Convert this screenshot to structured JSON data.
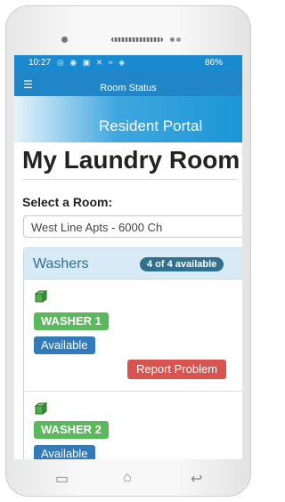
{
  "status_bar": {
    "time": "10:27",
    "icons": "◎ ◉ ▣ ✕ ≈ ◈",
    "battery": "86%"
  },
  "app_bar": {
    "menu_icon": "hamburger-icon",
    "title": "Room Status"
  },
  "banner": {
    "title": "Resident Portal"
  },
  "page": {
    "title": "My Laundry Room"
  },
  "room_select": {
    "label": "Select a Room:",
    "value": "West Line Apts - 6000 Ch"
  },
  "washers": {
    "title": "Washers",
    "badge": "4 of 4 available",
    "items": [
      {
        "name": "WASHER 1",
        "status": "Available",
        "action": "Report Problem"
      },
      {
        "name": "WASHER 2",
        "status": "Available"
      }
    ]
  },
  "colors": {
    "primary": "#2186c8",
    "success": "#5cb85c",
    "info": "#337ab7",
    "danger": "#d9534f",
    "panel": "#d9eaf7"
  },
  "nav": {
    "left_icon": "recent-apps-icon",
    "center_icon": "home-icon",
    "right_icon": "back-icon"
  }
}
